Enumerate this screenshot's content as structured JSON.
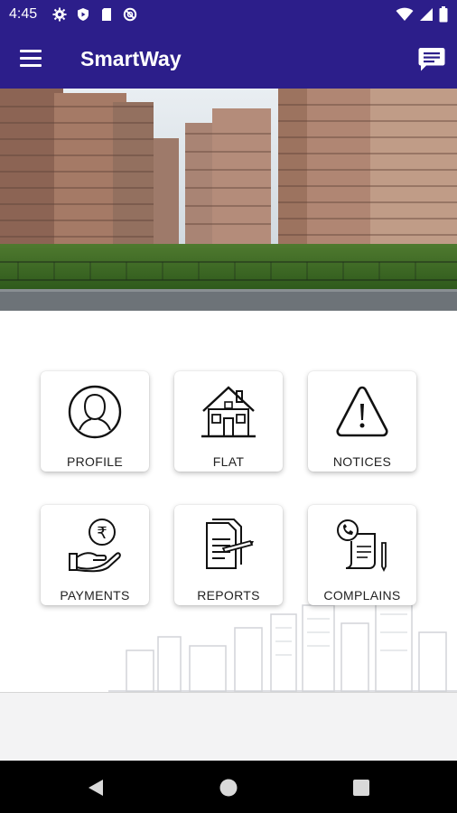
{
  "status_bar": {
    "time": "4:45",
    "left_icons": [
      "settings-icon",
      "shield-icon",
      "sd-card-icon",
      "no-disturb-icon"
    ],
    "right_icons": [
      "wifi-icon",
      "signal-icon",
      "battery-icon"
    ]
  },
  "app_bar": {
    "title": "SmartWay",
    "menu_icon": "hamburger-menu-icon",
    "action_icon": "chat-icon",
    "color": "#2c1e8a"
  },
  "banner": {
    "description_icon": "apartment-buildings-photo"
  },
  "tiles": [
    {
      "label": "PROFILE",
      "icon": "profile-icon"
    },
    {
      "label": "FLAT",
      "icon": "house-icon"
    },
    {
      "label": "NOTICES",
      "icon": "warning-icon"
    },
    {
      "label": "PAYMENTS",
      "icon": "rupee-payment-icon"
    },
    {
      "label": "REPORTS",
      "icon": "documents-icon"
    },
    {
      "label": "COMPLAINS",
      "icon": "phone-complaint-icon"
    }
  ],
  "nav_bar": {
    "back": "back-icon",
    "home": "home-icon",
    "recents": "recents-icon"
  }
}
